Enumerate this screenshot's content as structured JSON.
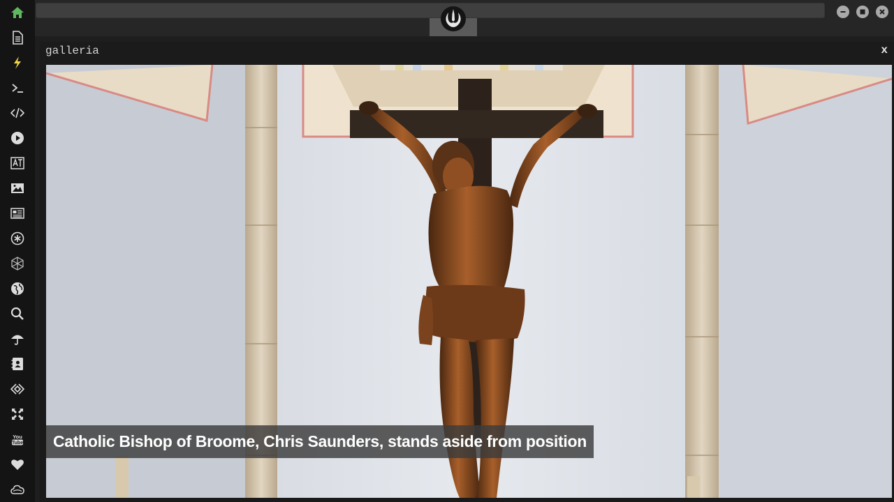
{
  "window": {
    "logo_icon": "rebel-alliance-icon",
    "controls": [
      "minimize-icon",
      "maximize-icon",
      "close-icon"
    ]
  },
  "sidebar": {
    "items": [
      {
        "icon": "home-icon",
        "color": "#5fb85f"
      },
      {
        "icon": "document-icon"
      },
      {
        "icon": "lightning-icon",
        "color": "#f0d54a"
      },
      {
        "icon": "terminal-icon"
      },
      {
        "icon": "code-icon"
      },
      {
        "icon": "play-icon"
      },
      {
        "icon": "translate-icon"
      },
      {
        "icon": "image-icon"
      },
      {
        "icon": "newspaper-icon"
      },
      {
        "icon": "snowflake-circle-icon"
      },
      {
        "icon": "hexagon-network-icon"
      },
      {
        "icon": "globe-icon"
      },
      {
        "icon": "search-icon"
      },
      {
        "icon": "umbrella-icon"
      },
      {
        "icon": "address-book-icon"
      },
      {
        "icon": "diamond-code-icon"
      },
      {
        "icon": "expand-icon"
      },
      {
        "icon": "youtube-icon"
      },
      {
        "icon": "heart-icon"
      },
      {
        "icon": "cloud-icon"
      }
    ]
  },
  "gallery": {
    "title": "galleria",
    "close_label": "x",
    "caption": "Catholic Bishop of Broome, Chris Saunders, stands aside from position"
  }
}
